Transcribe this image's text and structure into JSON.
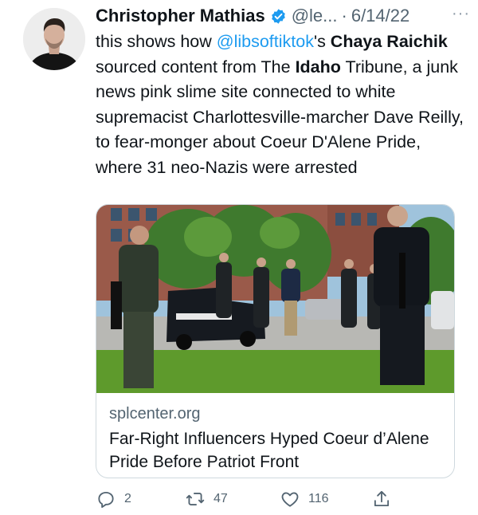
{
  "tweet": {
    "author": {
      "name": "Christopher Mathias",
      "handle": "@le...",
      "verified": true
    },
    "separator": "·",
    "date": "6/14/22",
    "more_label": "···",
    "text": {
      "intro": "this shows how ",
      "mention": "@libsoftiktok",
      "possessive": "'s ",
      "bold_name": "Chaya Raichik",
      "mid": " sourced content from The ",
      "bold_place": "Idaho",
      "rest": " Tribune, a junk news pink slime site connected to white supremacist Charlottesville-marcher Dave Reilly, to fear-monger about Coeur D'Alene Pride, where 31 neo-Nazis were arrested"
    },
    "card": {
      "domain": "splcenter.org",
      "title": "Far-Right Influencers Hyped Coeur d’Alene Pride Before Patriot Front"
    },
    "actions": {
      "reply_count": "2",
      "retweet_count": "47",
      "like_count": "116"
    }
  },
  "colors": {
    "link": "#1d9bf0",
    "secondary_text": "#536471",
    "verified_badge": "#1d9bf0",
    "card_border": "#cfd9de"
  }
}
